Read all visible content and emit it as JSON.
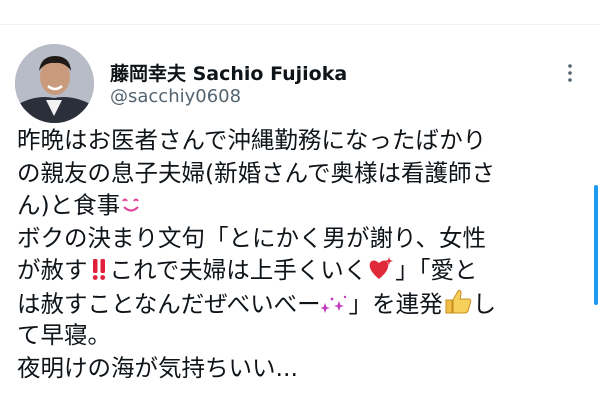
{
  "author": {
    "display_name": "藤岡幸夫 Sachio Fujioka",
    "handle": "@sacchiy0608"
  },
  "icons": {
    "avatar": "profile-photo",
    "more": "more-dots-icon",
    "smile": "smiling-face-emoji",
    "double_exclamation": "double-exclamation-emoji",
    "heart": "sparkling-heart-emoji",
    "sparkle": "sparkles-emoji",
    "thumbs": "thumbs-up-emoji"
  },
  "tweet": {
    "line1": "昨晩はお医者さんで沖縄勤務になったばかり",
    "line2": "の親友の息子夫婦(新婚さんで奥様は看護師さ",
    "line3_a": "ん)と食事",
    "line4": "ボクの決まり文句「とにかく男が謝り、女性",
    "line5_a": "が赦す",
    "line5_b": "これで夫婦は上手くいく",
    "line5_c": "」「愛と",
    "line6_a": "は赦すことなんだぜべいべー",
    "line6_b": "」を連発",
    "line6_c": "し",
    "line7": "て早寝。",
    "line8": "夜明けの海が気持ちいい..."
  },
  "colors": {
    "text": "#0f1419",
    "secondary": "#536471",
    "accent": "#1d9bf0"
  }
}
